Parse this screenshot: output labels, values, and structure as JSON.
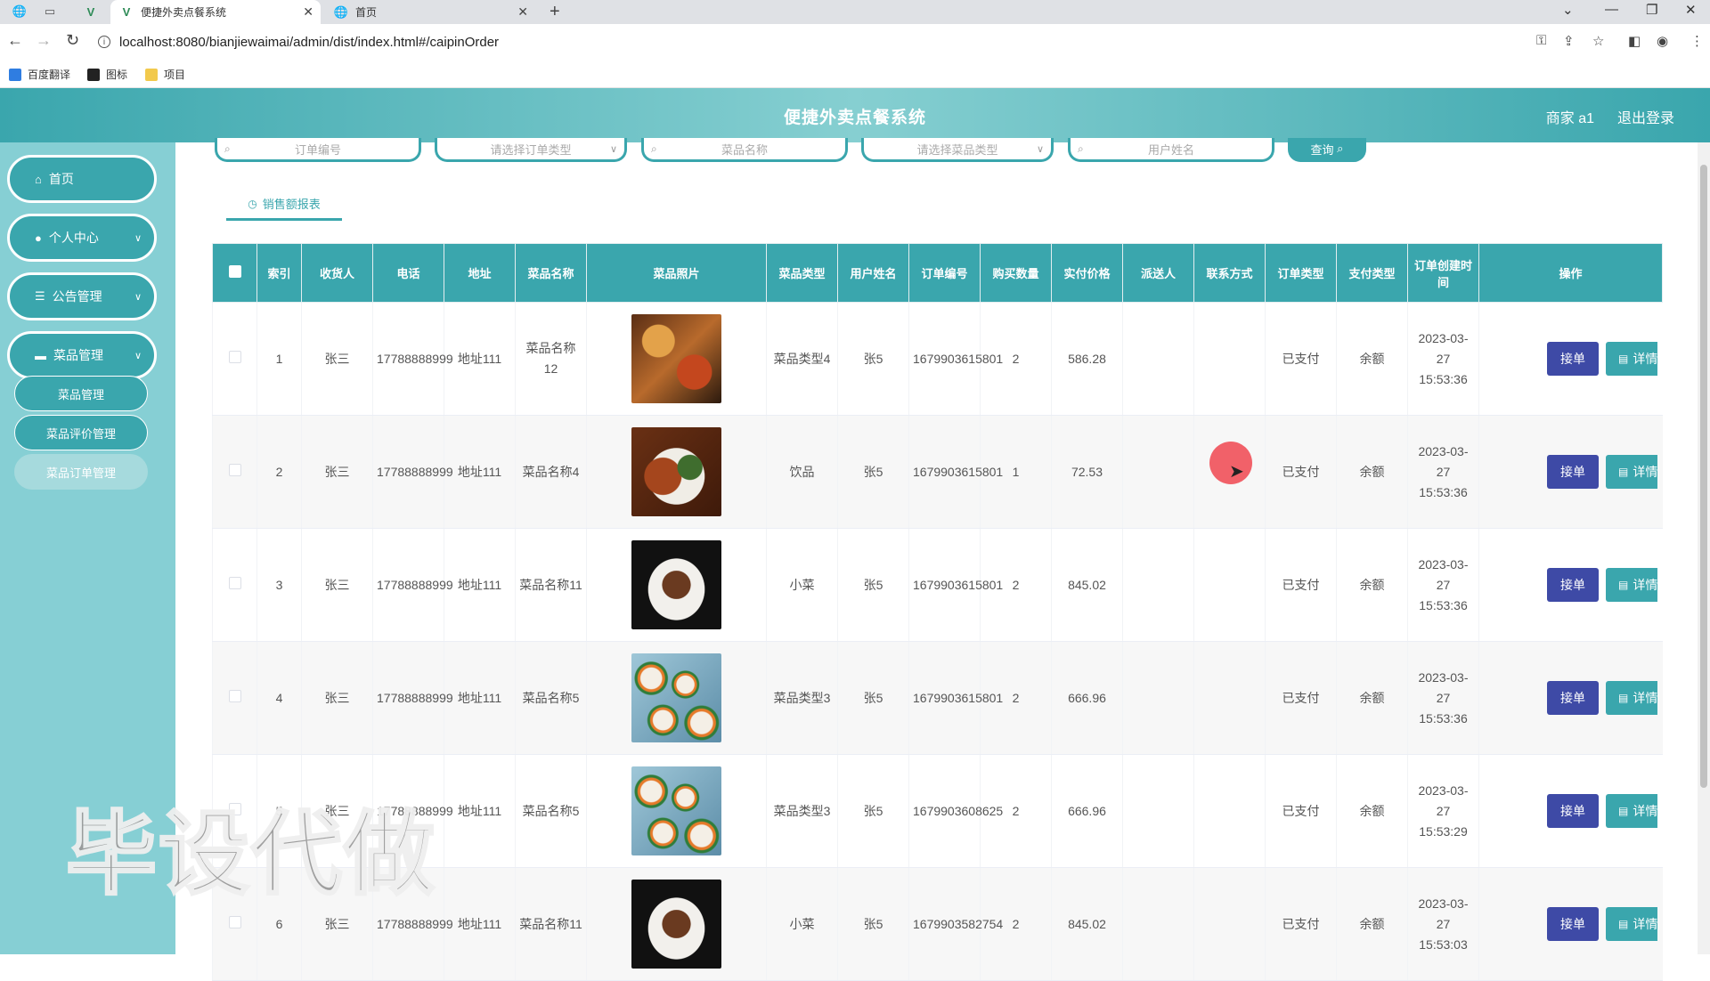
{
  "browser": {
    "tabs": [
      {
        "title": "便捷外卖点餐系统",
        "active": true
      },
      {
        "title": "首页",
        "active": false
      }
    ],
    "url": "localhost:8080/bianjiewaimai/admin/dist/index.html#/caipinOrder",
    "bookmarks": [
      "百度翻译",
      "图标",
      "项目"
    ]
  },
  "header": {
    "title": "便捷外卖点餐系统",
    "user": "商家 a1",
    "logout": "退出登录"
  },
  "sidebar": {
    "items": [
      {
        "label": "首页",
        "icon": "home-icon"
      },
      {
        "label": "个人中心",
        "icon": "user-icon"
      },
      {
        "label": "公告管理",
        "icon": "list-icon"
      },
      {
        "label": "菜品管理",
        "icon": "monitor-icon"
      }
    ],
    "sub_items": [
      "菜品管理",
      "菜品评价管理",
      "菜品订单管理"
    ],
    "active_sub": "菜品订单管理"
  },
  "search": {
    "order_no_placeholder": "订单编号",
    "order_type_placeholder": "请选择订单类型",
    "dish_name_placeholder": "菜品名称",
    "dish_type_placeholder": "请选择菜品类型",
    "user_name_placeholder": "用户姓名",
    "query_label": "查询"
  },
  "report_tab": "销售额报表",
  "table": {
    "columns": [
      "索引",
      "收货人",
      "电话",
      "地址",
      "菜品名称",
      "菜品照片",
      "菜品类型",
      "用户姓名",
      "订单编号",
      "购买数量",
      "实付价格",
      "派送人",
      "联系方式",
      "订单类型",
      "支付类型",
      "订单创建时间",
      "操作"
    ],
    "accept_label": "接单",
    "detail_label": "详情",
    "rows": [
      {
        "index": "1",
        "receiver": "张三",
        "phone": "17788888999",
        "address": "地址111",
        "dish": "菜品名称12",
        "photo": "dish-a",
        "dish_type": "菜品类型4",
        "user": "张5",
        "order_no": "1679903615801",
        "qty": "2",
        "price": "586.28",
        "courier": "",
        "contact": "",
        "order_type": "已支付",
        "pay_type": "余额",
        "created": "2023-03-27 15:53:36"
      },
      {
        "index": "2",
        "receiver": "张三",
        "phone": "17788888999",
        "address": "地址111",
        "dish": "菜品名称4",
        "photo": "dish-b",
        "dish_type": "饮品",
        "user": "张5",
        "order_no": "1679903615801",
        "qty": "1",
        "price": "72.53",
        "courier": "",
        "contact": "",
        "order_type": "已支付",
        "pay_type": "余额",
        "created": "2023-03-27 15:53:36"
      },
      {
        "index": "3",
        "receiver": "张三",
        "phone": "17788888999",
        "address": "地址111",
        "dish": "菜品名称11",
        "photo": "dish-c",
        "dish_type": "小菜",
        "user": "张5",
        "order_no": "1679903615801",
        "qty": "2",
        "price": "845.02",
        "courier": "",
        "contact": "",
        "order_type": "已支付",
        "pay_type": "余额",
        "created": "2023-03-27 15:53:36"
      },
      {
        "index": "4",
        "receiver": "张三",
        "phone": "17788888999",
        "address": "地址111",
        "dish": "菜品名称5",
        "photo": "dish-d",
        "dish_type": "菜品类型3",
        "user": "张5",
        "order_no": "1679903615801",
        "qty": "2",
        "price": "666.96",
        "courier": "",
        "contact": "",
        "order_type": "已支付",
        "pay_type": "余额",
        "created": "2023-03-27 15:53:36"
      },
      {
        "index": "5",
        "receiver": "张三",
        "phone": "17788888999",
        "address": "地址111",
        "dish": "菜品名称5",
        "photo": "dish-d",
        "dish_type": "菜品类型3",
        "user": "张5",
        "order_no": "1679903608625",
        "qty": "2",
        "price": "666.96",
        "courier": "",
        "contact": "",
        "order_type": "已支付",
        "pay_type": "余额",
        "created": "2023-03-27 15:53:29"
      },
      {
        "index": "6",
        "receiver": "张三",
        "phone": "17788888999",
        "address": "地址111",
        "dish": "菜品名称11",
        "photo": "dish-c",
        "dish_type": "小菜",
        "user": "张5",
        "order_no": "1679903582754",
        "qty": "2",
        "price": "845.02",
        "courier": "",
        "contact": "",
        "order_type": "已支付",
        "pay_type": "余额",
        "created": "2023-03-27 15:53:03"
      }
    ]
  },
  "watermark": "毕设代做",
  "colors": {
    "accent": "#3aa6ad",
    "accept": "#3e4aa6",
    "sidebar": "#86cfd4"
  }
}
